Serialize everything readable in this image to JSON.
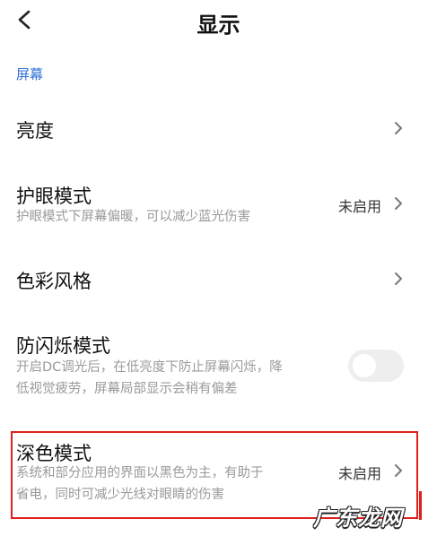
{
  "header": {
    "title": "显示",
    "back_icon": "chevron-left-icon"
  },
  "section": {
    "label": "屏幕"
  },
  "settings": {
    "brightness": {
      "title": "亮度"
    },
    "eye_care": {
      "title": "护眼模式",
      "desc": "护眼模式下屏幕偏暖，可以减少蓝光伤害",
      "value": "未启用"
    },
    "color_style": {
      "title": "色彩风格"
    },
    "anti_flicker": {
      "title": "防闪烁模式",
      "desc_line1": "开启DC调光后，在低亮度下防止屏幕闪烁，降",
      "desc_line2": "低视觉疲劳，屏幕局部显示会稍有偏差",
      "toggle_on": false
    },
    "dark_mode": {
      "title": "深色模式",
      "desc_line1": "系统和部分应用的界面以黑色为主，有助于",
      "desc_line2": "省电，同时可减少光线对眼睛的伤害",
      "value": "未启用"
    }
  },
  "watermark": {
    "text": "广东龙网"
  },
  "colors": {
    "section_label": "#2f6fd6",
    "highlight": "#e0201c"
  }
}
